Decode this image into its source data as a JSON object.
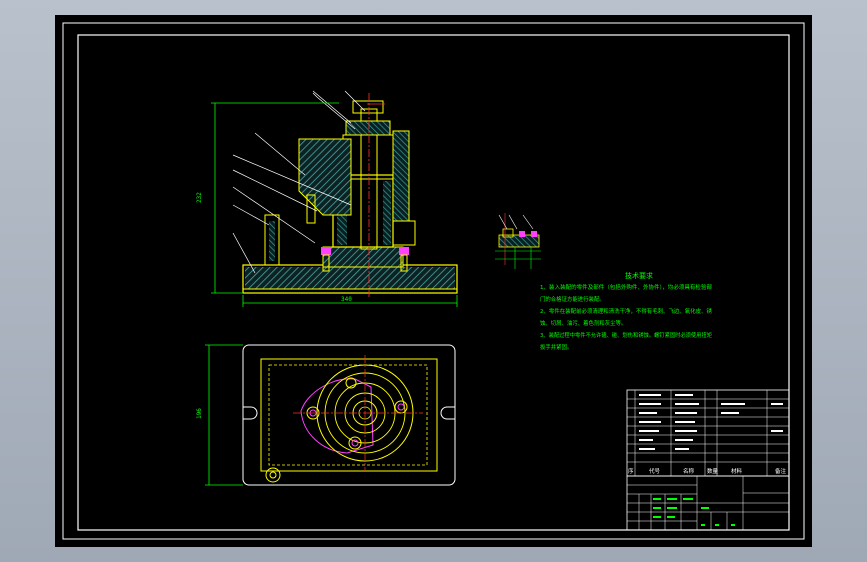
{
  "drawing": {
    "background": "#000000",
    "frame_color": "#ffffff",
    "part_color": "#ffff00",
    "hatch_color": "#4aa6a6",
    "note_color": "#00ff00",
    "center_color": "#ff3030",
    "fastener_color": "#ff40ff"
  },
  "front_view": {
    "dim_overall_height": "232",
    "dim_base_width": "340"
  },
  "top_view": {
    "dim_height": "196"
  },
  "tech_notes": {
    "title": "技术要求",
    "lines": [
      "1、装入装配的零件及部件（包括外购件、外协件），均必须具有检验部",
      "门的合格证方能进行装配。",
      "2、零件在装配前必须清理和清洗干净，不得有毛刺、飞边、氧化皮、锈",
      "蚀、切屑、油污、着色剂和灰尘等。",
      "3、装配过程中零件不允许磕、碰、划伤和锈蚀。螺钉紧固时必须使用扭矩",
      "扳手并紧固。"
    ]
  },
  "title_block": {
    "col_headers": [
      "序",
      "代号",
      "名称",
      "数量",
      "材料",
      "备注"
    ]
  }
}
